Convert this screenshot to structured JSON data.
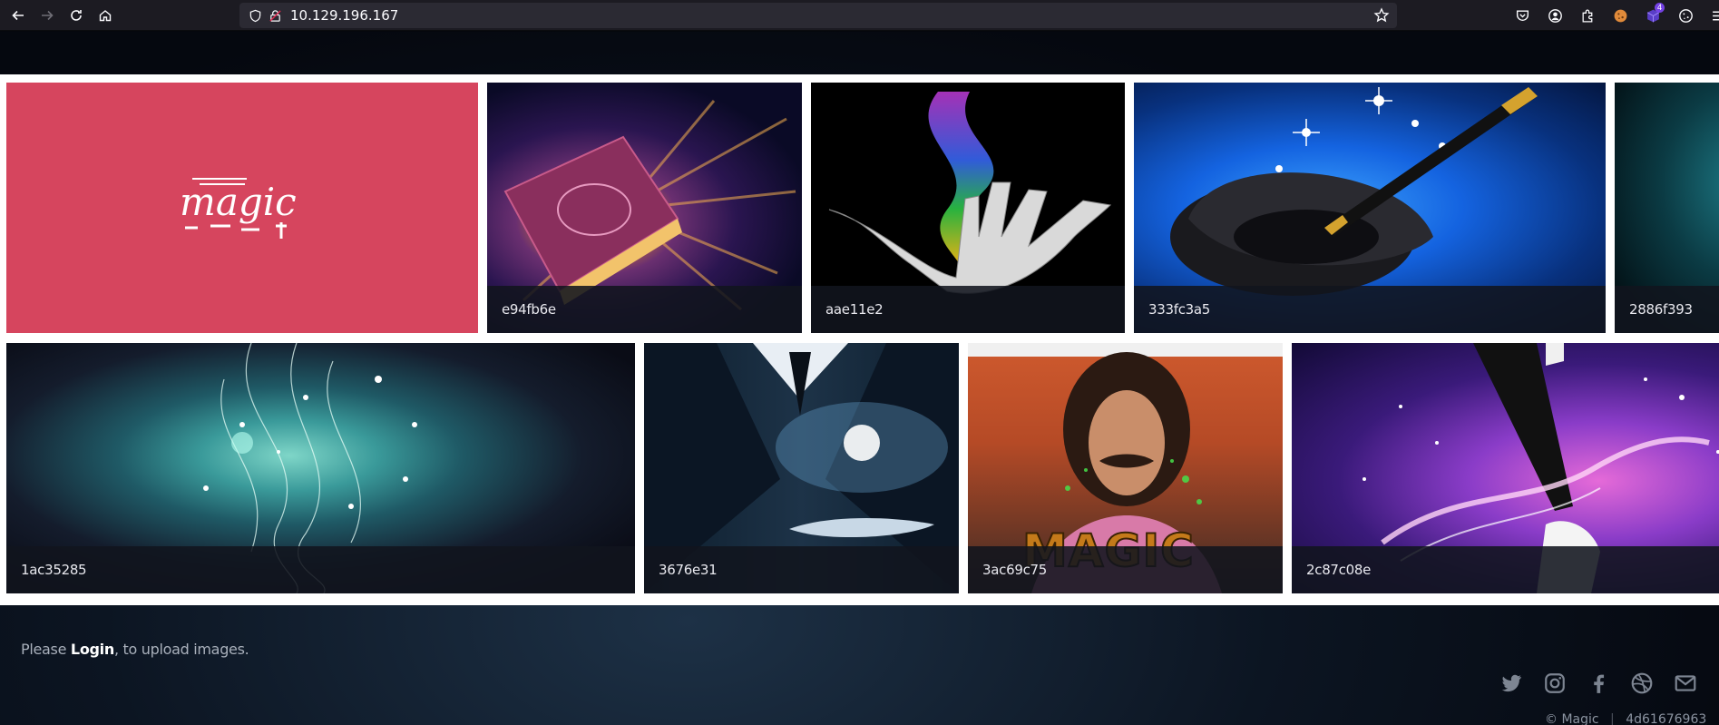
{
  "browser": {
    "url": "10.129.196.167",
    "extension_badge": "4"
  },
  "gallery": {
    "logo_text": "magic",
    "tiles": [
      {
        "caption": "e94fb6e"
      },
      {
        "caption": "aae11e2"
      },
      {
        "caption": "333fc3a5"
      },
      {
        "caption": "2886f393"
      },
      {
        "caption": "1ac35285"
      },
      {
        "caption": "3676e31"
      },
      {
        "caption": "3ac69c75"
      },
      {
        "caption": "2c87c08e"
      }
    ],
    "magic_overlay_text": "MAGIC"
  },
  "footer": {
    "prefix": "Please ",
    "login_link": "Login",
    "suffix": ", to upload images.",
    "copyright": "© Magic",
    "hash": "4d61676963"
  },
  "icons": {
    "social": [
      "twitter-icon",
      "instagram-icon",
      "facebook-icon",
      "dribbble-icon",
      "mail-icon"
    ]
  },
  "colors": {
    "logo_tile": "#d6455e",
    "caption_bg": "#11151e",
    "browser_chrome": "#1c1b22"
  }
}
